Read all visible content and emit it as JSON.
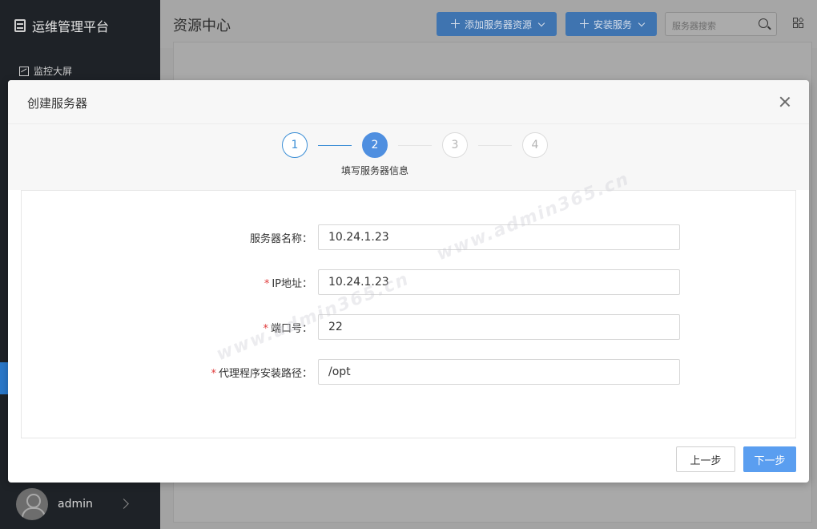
{
  "sidebar": {
    "brand": "运维管理平台",
    "brand_icon": "server-icon",
    "menu": [
      {
        "label": "监控大屏",
        "icon": "chart-icon"
      }
    ],
    "user": {
      "name": "admin",
      "icon": "avatar-icon"
    }
  },
  "header": {
    "title": "资源中心",
    "add_server_button": "添加服务器资源",
    "install_service_button": "安装服务",
    "search_placeholder": "服务器搜索",
    "grid_icon": "grid-icon"
  },
  "modal": {
    "title": "创建服务器",
    "steps": [
      {
        "number": "1",
        "state": "done"
      },
      {
        "number": "2",
        "state": "active",
        "label": "填写服务器信息"
      },
      {
        "number": "3",
        "state": "todo"
      },
      {
        "number": "4",
        "state": "todo"
      }
    ],
    "fields": [
      {
        "label": "服务器名称：",
        "required": false,
        "value": "10.24.1.23"
      },
      {
        "label": "IP地址：",
        "required": true,
        "value": "10.24.1.23"
      },
      {
        "label": "端口号：",
        "required": true,
        "value": "22"
      },
      {
        "label": "代理程序安装路径：",
        "required": true,
        "value": "/opt"
      }
    ],
    "prev_button": "上一步",
    "next_button": "下一步"
  },
  "watermark": "www.admin365.cn",
  "colors": {
    "accent": "#5a9ef0",
    "sidebar": "#1e2227",
    "required": "#e03a3a"
  }
}
